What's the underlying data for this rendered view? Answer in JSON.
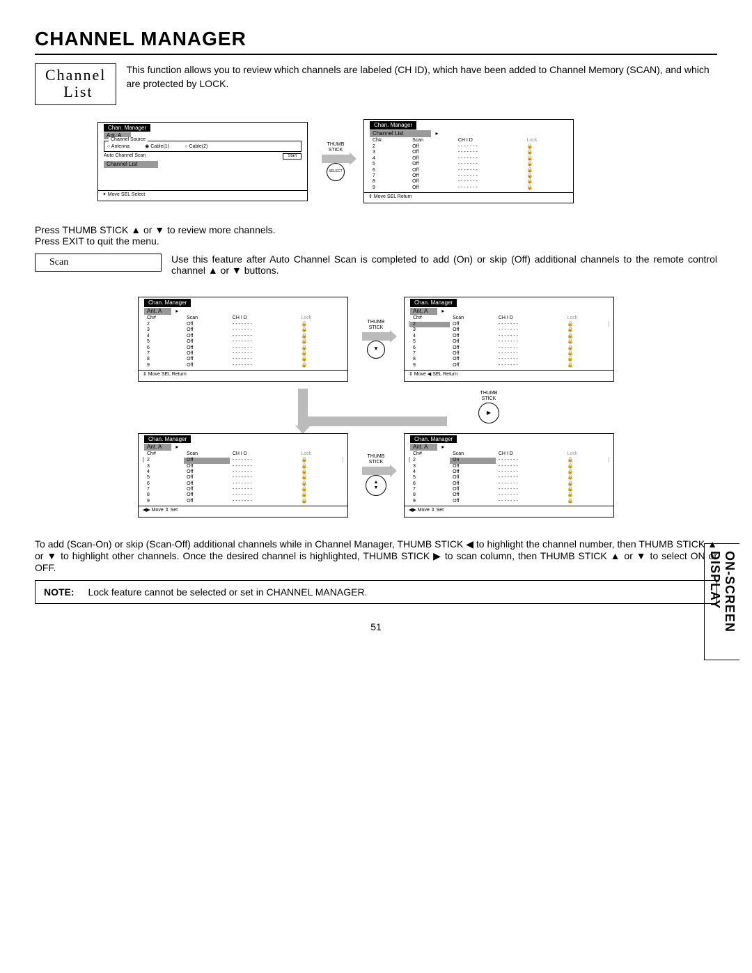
{
  "page_title": "CHANNEL MANAGER",
  "side_tab": "ON-SCREEN DISPLAY",
  "page_number": "51",
  "channel_list": {
    "box_label": "Channel\n List",
    "intro": "This function allows you to review which channels are labeled (CH ID), which have been added to Channel Memory (SCAN), and which are protected by LOCK."
  },
  "thumb_label": "THUMB\nSTICK",
  "select_label": "SELECT",
  "menu1": {
    "header": "Chan. Manager",
    "sub": "Ant. A",
    "group": "Channel Source",
    "r1": "Antenna",
    "r2": "Cable(1)",
    "r3": "Cable(2)",
    "auto_scan": "Auto Channel Scan",
    "start": "Start",
    "chan_list": "Channel List",
    "footer": "✦ Move  SEL  Select"
  },
  "list_headers": {
    "c1": "Ch#",
    "c2": "Scan",
    "c3": "CH I D",
    "c4": "Lock"
  },
  "list_rows": [
    {
      "ch": "2",
      "scan": "Off",
      "chid": "- - - - - - -",
      "lock": "🔒"
    },
    {
      "ch": "3",
      "scan": "Off",
      "chid": "- - - - - - -",
      "lock": "🔒"
    },
    {
      "ch": "4",
      "scan": "Off",
      "chid": "- - - - - - -",
      "lock": "🔒"
    },
    {
      "ch": "5",
      "scan": "Off",
      "chid": "- - - - - - -",
      "lock": "🔒"
    },
    {
      "ch": "6",
      "scan": "Off",
      "chid": "- - - - - - -",
      "lock": "🔒"
    },
    {
      "ch": "7",
      "scan": "Off",
      "chid": "- - - - - - -",
      "lock": "🔒"
    },
    {
      "ch": "8",
      "scan": "Off",
      "chid": "- - - - - - -",
      "lock": "🔒"
    },
    {
      "ch": "9",
      "scan": "Off",
      "chid": "- - - - - - -",
      "lock": "🔒"
    }
  ],
  "list_footer_return": "⇕ Move  SEL  Return",
  "list_footer_lr_return": "⇕ Move   ◀ SEL  Return",
  "list_footer_set": "◀▶ Move   ⇕ Set",
  "review_text": "Press THUMB STICK ▲ or ▼ to review more channels.\nPress EXIT to quit the menu.",
  "scan": {
    "box": "Scan",
    "desc": "Use this feature after Auto Channel Scan is completed to add (On) or skip (Off) additional channels to the remote control channel ▲ or ▼ buttons."
  },
  "on_value": "On",
  "scan_instructions": "To add (Scan-On) or skip (Scan-Off) additional channels while in Channel Manager, THUMB STICK ◀ to highlight the channel number, then THUMB STICK ▲ or ▼ to highlight other channels.  Once the desired channel is highlighted, THUMB STICK ▶ to scan column, then THUMB STICK ▲ or ▼ to select ON or OFF.",
  "note_label": "NOTE:",
  "note_text": "Lock feature cannot be selected or set in CHANNEL MANAGER."
}
